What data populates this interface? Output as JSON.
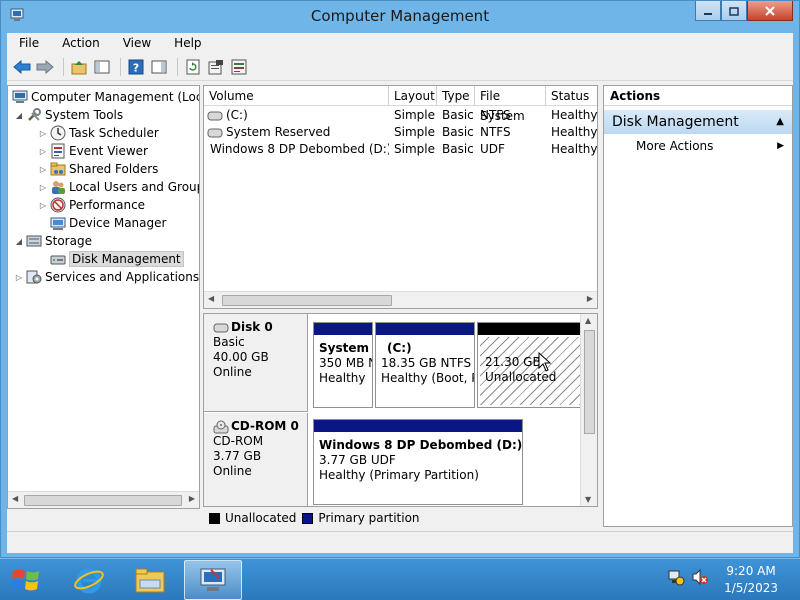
{
  "window": {
    "title": "Computer Management"
  },
  "menu": [
    "File",
    "Action",
    "View",
    "Help"
  ],
  "tree": {
    "root": "Computer Management (Local",
    "system_tools": "System Tools",
    "task_scheduler": "Task Scheduler",
    "event_viewer": "Event Viewer",
    "shared_folders": "Shared Folders",
    "local_users": "Local Users and Groups",
    "performance": "Performance",
    "device_manager": "Device Manager",
    "storage": "Storage",
    "disk_management": "Disk Management",
    "services": "Services and Applications"
  },
  "volumes": {
    "columns": [
      "Volume",
      "Layout",
      "Type",
      "File System",
      "Status"
    ],
    "rows": [
      {
        "volume": "(C:)",
        "layout": "Simple",
        "type": "Basic",
        "fs": "NTFS",
        "status": "Healthy ("
      },
      {
        "volume": "System Reserved",
        "layout": "Simple",
        "type": "Basic",
        "fs": "NTFS",
        "status": "Healthy ("
      },
      {
        "volume": "Windows 8 DP Debombed (D:)",
        "layout": "Simple",
        "type": "Basic",
        "fs": "UDF",
        "status": "Healthy ("
      }
    ]
  },
  "disks": [
    {
      "name": "Disk 0",
      "kind": "Basic",
      "size": "40.00 GB",
      "state": "Online",
      "partitions": [
        {
          "name": "System",
          "size": "350 MB N",
          "status": "Healthy"
        },
        {
          "name": "(C:)",
          "size": "18.35 GB NTFS",
          "status": "Healthy (Boot, P"
        },
        {
          "name": "",
          "size": "21.30 GB",
          "status": "Unallocated"
        }
      ]
    },
    {
      "name": "CD-ROM 0",
      "kind": "CD-ROM",
      "size": "3.77 GB",
      "state": "Online",
      "partitions": [
        {
          "name": "Windows 8 DP Debombed  (D:)",
          "size": "3.77 GB UDF",
          "status": "Healthy (Primary Partition)"
        }
      ]
    }
  ],
  "legend": {
    "unallocated": "Unallocated",
    "primary": "Primary partition"
  },
  "actions": {
    "header": "Actions",
    "section": "Disk Management",
    "more": "More Actions"
  },
  "clock": {
    "time": "9:20 AM",
    "date": "1/5/2023"
  },
  "colors": {
    "primary_partition": "#0a1682",
    "unallocated": "#000000",
    "taskbar": "#2b78bd"
  }
}
